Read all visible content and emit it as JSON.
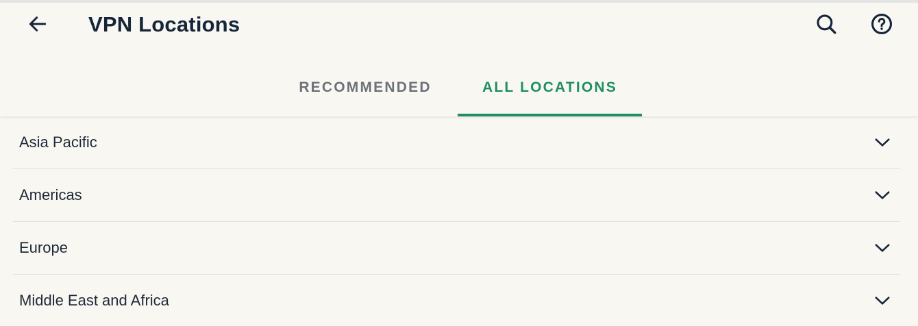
{
  "header": {
    "title": "VPN Locations",
    "back_icon": "arrow-left-icon",
    "search_icon": "search-icon",
    "help_icon": "help-circle-icon"
  },
  "tabs": [
    {
      "label": "RECOMMENDED",
      "selected": false
    },
    {
      "label": "ALL LOCATIONS",
      "selected": true
    }
  ],
  "regions": [
    {
      "label": "Asia Pacific",
      "icon": "chevron-down-icon"
    },
    {
      "label": "Americas",
      "icon": "chevron-down-icon"
    },
    {
      "label": "Europe",
      "icon": "chevron-down-icon"
    },
    {
      "label": "Middle East and Africa",
      "icon": "chevron-down-icon"
    }
  ],
  "colors": {
    "background": "#f9f7f2",
    "accent": "#1f8f63",
    "title_text": "#16263a",
    "inactive_tab": "#6c7278"
  }
}
